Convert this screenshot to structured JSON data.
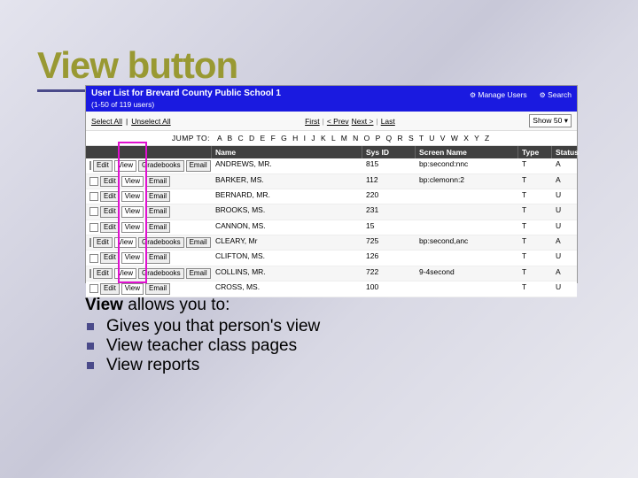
{
  "slide": {
    "title": "View button",
    "lead_strong": "View",
    "lead_rest": " allows you to:",
    "bullets": [
      "Gives you that person's view",
      "View teacher class pages",
      "View reports"
    ]
  },
  "screenshot": {
    "header_title": "User List for Brevard County Public School 1",
    "header_sub": "(1-50 of 119 users)",
    "header_right": {
      "manage": "Manage Users",
      "search": "Search"
    },
    "toolbar": {
      "select_all": "Select All",
      "unselect_all": "Unselect All",
      "pager": {
        "first": "First",
        "prev": "< Prev",
        "next": "Next >",
        "last": "Last"
      },
      "show_label": "Show 50 ▾"
    },
    "jumpto_label": "JUMP TO:",
    "alphabet": "A B C D E F G H I J K L M N O P Q R S T U V W X Y Z",
    "columns": {
      "name": "Name",
      "sysid": "Sys ID",
      "screen": "Screen Name",
      "type": "Type",
      "status": "Status"
    },
    "actions": {
      "edit": "Edit",
      "view": "View",
      "gradebooks": "Gradebooks",
      "email": "Email"
    },
    "rows": [
      {
        "name": "ANDREWS, MR.",
        "sysid": "815",
        "screen": "bp:second:nnc",
        "type": "T",
        "status": "A",
        "gb": true
      },
      {
        "name": "BARKER, MS.",
        "sysid": "112",
        "screen": "bp:clemonn:2",
        "type": "T",
        "status": "A",
        "gb": false
      },
      {
        "name": "BERNARD, MR.",
        "sysid": "220",
        "screen": "",
        "type": "T",
        "status": "U",
        "gb": false
      },
      {
        "name": "BROOKS, MS.",
        "sysid": "231",
        "screen": "",
        "type": "T",
        "status": "U",
        "gb": false
      },
      {
        "name": "CANNON, MS.",
        "sysid": "15",
        "screen": "",
        "type": "T",
        "status": "U",
        "gb": false
      },
      {
        "name": "CLEARY, Mr",
        "sysid": "725",
        "screen": "bp:second,anc",
        "type": "T",
        "status": "A",
        "gb": true
      },
      {
        "name": "CLIFTON, MS.",
        "sysid": "126",
        "screen": "",
        "type": "T",
        "status": "U",
        "gb": false
      },
      {
        "name": "COLLINS, MR.",
        "sysid": "722",
        "screen": "9-4second",
        "type": "T",
        "status": "A",
        "gb": true
      },
      {
        "name": "CROSS, MS.",
        "sysid": "100",
        "screen": "",
        "type": "T",
        "status": "U",
        "gb": false
      }
    ]
  }
}
